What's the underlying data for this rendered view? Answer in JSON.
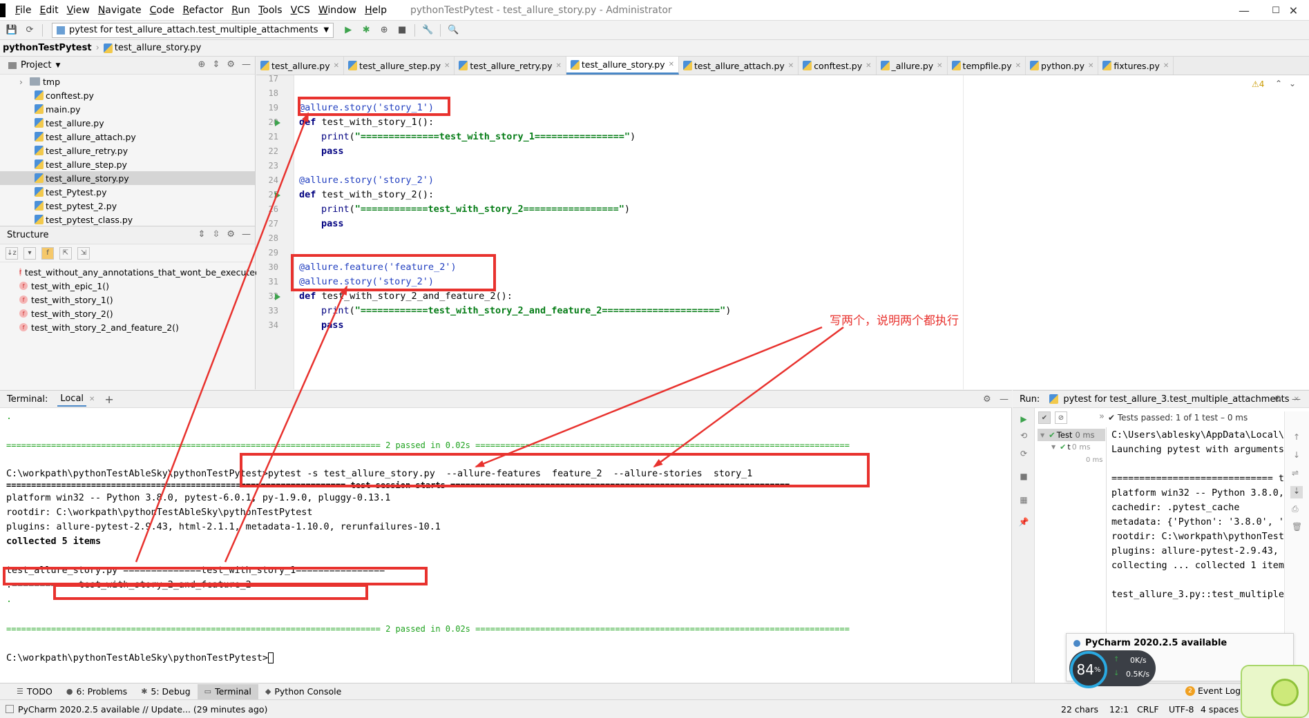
{
  "window": {
    "title": "pythonTestPytest - test_allure_story.py - Administrator",
    "menu": [
      {
        "u": "F",
        "rest": "ile"
      },
      {
        "u": "E",
        "rest": "dit"
      },
      {
        "u": "V",
        "rest": "iew"
      },
      {
        "u": "N",
        "rest": "avigate"
      },
      {
        "u": "C",
        "rest": "ode"
      },
      {
        "u": "R",
        "rest": "efactor"
      },
      {
        "u": "R",
        "rest": "un"
      },
      {
        "u": "T",
        "rest": "ools"
      },
      {
        "u": "V",
        "rest": "CS"
      },
      {
        "u": "W",
        "rest": "indow"
      },
      {
        "u": "H",
        "rest": "elp"
      }
    ],
    "minimize": "—",
    "maximize": "☐",
    "close": "✕"
  },
  "toolbar": {
    "run_config": "pytest for test_allure_attach.test_multiple_attachments"
  },
  "breadcrumb": {
    "project": "pythonTestPytest",
    "file": "test_allure_story.py"
  },
  "project_panel": {
    "title": "Project",
    "items": [
      {
        "label": "tmp",
        "type": "folder"
      },
      {
        "label": "conftest.py",
        "type": "file"
      },
      {
        "label": "main.py",
        "type": "file"
      },
      {
        "label": "test_allure.py",
        "type": "file"
      },
      {
        "label": "test_allure_attach.py",
        "type": "file"
      },
      {
        "label": "test_allure_retry.py",
        "type": "file"
      },
      {
        "label": "test_allure_step.py",
        "type": "file"
      },
      {
        "label": "test_allure_story.py",
        "type": "file",
        "selected": true
      },
      {
        "label": "test_Pytest.py",
        "type": "file"
      },
      {
        "label": "test_pytest_2.py",
        "type": "file"
      },
      {
        "label": "test_pytest_class.py",
        "type": "file"
      }
    ]
  },
  "structure_panel": {
    "title": "Structure",
    "items": [
      "test_without_any_annotations_that_wont_be_executed()",
      "test_with_epic_1()",
      "test_with_story_1()",
      "test_with_story_2()",
      "test_with_story_2_and_feature_2()"
    ]
  },
  "editor": {
    "tabs": [
      "test_allure.py",
      "test_allure_step.py",
      "test_allure_retry.py",
      "test_allure_story.py",
      "test_allure_attach.py",
      "conftest.py",
      "_allure.py",
      "tempfile.py",
      "python.py",
      "fixtures.py"
    ],
    "active_tab": "test_allure_story.py",
    "warnings": "⚠4",
    "line_numbers": [
      "17",
      "18",
      "19",
      "20",
      "21",
      "22",
      "23",
      "24",
      "25",
      "26",
      "27",
      "28",
      "29",
      "30",
      "31",
      "32",
      "33",
      "34"
    ],
    "code": {
      "l19": "@allure.story('story_1')",
      "l20_kw": "def",
      "l20_rest": " test_with_story_1():",
      "l21_fn": "print",
      "l21_str": "\"==============test_with_story_1================\"",
      "l22": "pass",
      "l24": "@allure.story('story_2')",
      "l25_kw": "def",
      "l25_rest": " test_with_story_2():",
      "l26_fn": "print",
      "l26_str": "\"============test_with_story_2=================\"",
      "l27": "pass",
      "l30": "@allure.feature('feature_2')",
      "l31": "@allure.story('story_2')",
      "l32_kw": "def",
      "l32_rest": " test_with_story_2_and_feature_2():",
      "l33_fn": "print",
      "l33_str": "\"============test_with_story_2_and_feature_2=====================\"",
      "l34": "pass"
    }
  },
  "terminal": {
    "title": "Terminal:",
    "tab": "Local",
    "lines": {
      "dot1": ".",
      "passed1": "=========================================================================== 2 passed in 0.02s ===========================================================================",
      "cmd": "C:\\workpath\\pythonTestAbleSky\\pythonTestPytest>pytest -s test_allure_story.py  --allure-features  feature_2  --allure-stories  story_1",
      "session": "==================================================================== test session starts ====================================================================",
      "platform": "platform win32 -- Python 3.8.0, pytest-6.0.1, py-1.9.0, pluggy-0.13.1",
      "rootdir": "rootdir: C:\\workpath\\pythonTestAbleSky\\pythonTestPytest",
      "plugins": "plugins: allure-pytest-2.9.43, html-2.1.1, metadata-1.10.0, rerunfailures-10.1",
      "collected": "collected 5 items",
      "out1": "test_allure_story.py ==============test_with_story_1================",
      "out2": ".============test_with_story_2_and_feature_2=====================",
      "dot2": ".",
      "passed2": "=========================================================================== 2 passed in 0.02s ===========================================================================",
      "prompt": "C:\\workpath\\pythonTestAbleSky\\pythonTestPytest>"
    }
  },
  "run_panel": {
    "title": "Run:",
    "config": "pytest for test_allure_3.test_multiple_attachments",
    "status": "✔ Tests passed: 1 of 1 test – 0 ms",
    "tree": [
      {
        "label": "Test",
        "time": "0 ms"
      },
      {
        "label": "t",
        "time": "0 ms"
      },
      {
        "label": "",
        "time": "0 ms"
      }
    ],
    "output": [
      "C:\\Users\\ablesky\\AppData\\Local\\",
      "Launching pytest with arguments",
      "",
      "============================= t",
      "platform win32 -- Python 3.8.0,",
      "cachedir: .pytest_cache",
      "metadata: {'Python': '3.8.0', '",
      "rootdir: C:\\workpath\\pythonTest",
      "plugins: allure-pytest-2.9.43,",
      "collecting ... collected 1 item",
      "",
      "test_allure_3.py::test_multiple",
      "",
      "",
      "",
      "=============================="
    ]
  },
  "bottom_tools": [
    {
      "label": "TODO",
      "icon": "☰"
    },
    {
      "label": "6: Problems",
      "icon": "●"
    },
    {
      "label": "5: Debug",
      "icon": "✱"
    },
    {
      "label": "Terminal",
      "icon": "▭",
      "active": true
    },
    {
      "label": "Python Console",
      "icon": "◆"
    }
  ],
  "event_log": "Event Log",
  "event_log_count": "2",
  "status_bar": {
    "message": "PyCharm 2020.2.5 available // Update... (29 minutes ago)",
    "chars": "22 chars",
    "position": "12:1",
    "line_sep": "CRLF",
    "encoding": "UTF-8",
    "indent": "4 spaces",
    "extra": "P"
  },
  "notification": {
    "title": "PyCharm 2020.2.5 available"
  },
  "net_meter": {
    "percent": "84",
    "percent_sign": "%",
    "up": "0K/s",
    "down": "0.5K/s"
  },
  "annotation": {
    "text": "写两个，说明两个都执行"
  },
  "colors": {
    "annotation_red": "#e8322e",
    "pass_green": "#1ea21e",
    "active_tab_underline": "#4a88c7"
  }
}
